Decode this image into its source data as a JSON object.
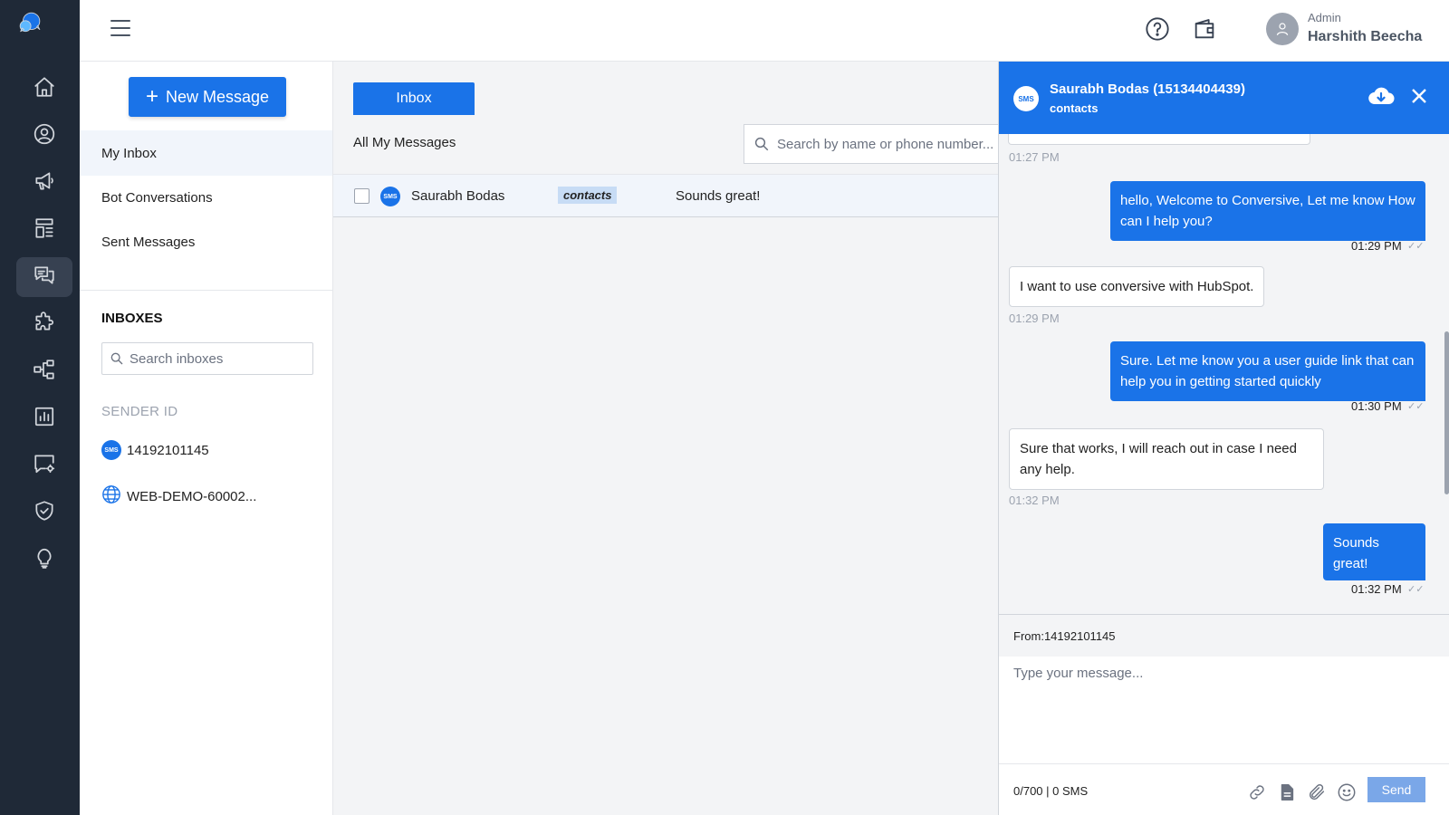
{
  "app": {
    "brand_color": "#1a73e8",
    "rail_color": "#1f2937"
  },
  "rail": {
    "items": [
      {
        "icon": "home-icon"
      },
      {
        "icon": "user-circle-icon"
      },
      {
        "icon": "megaphone-icon"
      },
      {
        "icon": "layout-icon"
      },
      {
        "icon": "chat-bubbles-icon",
        "active": true
      },
      {
        "icon": "puzzle-icon"
      },
      {
        "icon": "workflow-icon"
      },
      {
        "icon": "bar-chart-icon"
      },
      {
        "icon": "chat-settings-icon"
      },
      {
        "icon": "shield-check-icon"
      },
      {
        "icon": "lightbulb-icon"
      }
    ]
  },
  "header": {
    "user_role": "Admin",
    "user_name": "Harshith Beecha"
  },
  "sidebar": {
    "new_message_label": "New Message",
    "links": [
      "My Inbox",
      "Bot Conversations",
      "Sent Messages"
    ],
    "inboxes_title": "INBOXES",
    "search_placeholder": "Search inboxes",
    "sender_title": "SENDER ID",
    "senders": [
      {
        "label": "14192101145",
        "type": "sms"
      },
      {
        "label": "WEB-DEMO-60002...",
        "type": "web"
      }
    ],
    "sms_badge": "SMS"
  },
  "messages": {
    "tab_label": "Inbox",
    "list_title": "All My Messages",
    "search_placeholder": "Search by name or phone number...",
    "rows": [
      {
        "name": "Saurabh Bodas",
        "tag": "contacts",
        "preview": "Sounds great!"
      }
    ]
  },
  "conversation": {
    "title": "Saurabh Bodas (15134404439)",
    "subtitle": "contacts",
    "badge": "SMS",
    "thread": [
      {
        "time": "01:27 PM"
      },
      {
        "dir": "out",
        "text": "hello, Welcome to Conversive, Let me know How can I help you?",
        "time": "01:29 PM"
      },
      {
        "dir": "in",
        "text": "I want to use conversive with HubSpot.",
        "time": "01:29 PM"
      },
      {
        "dir": "out",
        "text": "Sure. Let me know you a user guide link that can help you in getting started quickly",
        "time": "01:30 PM"
      },
      {
        "dir": "in",
        "text": "Sure that works, I will reach out in case I need any help.",
        "time": "01:32 PM"
      },
      {
        "dir": "out",
        "text": "Sounds great!",
        "time": "01:32 PM"
      }
    ],
    "from_label": "From:14192101145",
    "compose_placeholder": "Type your message...",
    "counter": "0/700 | 0 SMS",
    "send_label": "Send"
  }
}
